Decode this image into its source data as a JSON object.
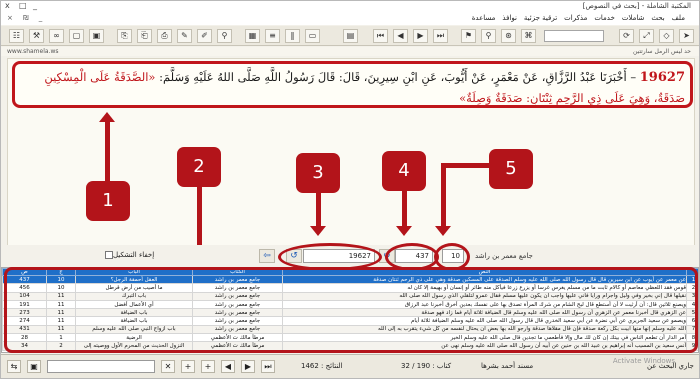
{
  "window": {
    "title": "المكتبة الشاملة - [بحث في النصوص]",
    "controls": [
      "_",
      "□",
      "x"
    ]
  },
  "menu": {
    "items": [
      "ملف",
      "بحث",
      "شاملات",
      "خدمات",
      "مذكرات",
      "ترقية جزئية",
      "نوافذ",
      "مساعدة"
    ],
    "mini": "_ ₪ ×"
  },
  "infostrip": {
    "right": "حد ليس الرمل سارتتين",
    "left": "www.shamela.ws"
  },
  "hadith": {
    "number": "19627",
    "isnad": "– أَخْبَرَنَا عَبْدُ الرَّزَّاقِ، عَنْ مَعْمَرٍ، عَنْ أَيُّوبَ، عَنِ ابْنِ سِيرِينَ، قَالَ: قَالَ رَسُولُ اللَّهِ صَلَّى اللهُ عَلَيْهِ وَسَلَّمَ: ",
    "matn": "«الصَّدَقَةُ عَلَى الْمِسْكِينِ صَدَقَةٌ، وَهِيَ عَلَى ذِي الرَّحِمِ ثِنْتَانِ: صَدَقَةٌ وَصِلَةٌ»"
  },
  "controls": {
    "checkbox_label": "إخفاء التشكيل",
    "hadith_field": "19627",
    "page_field": "437",
    "part_field": "10",
    "book_label": "جامع معمر بن راشد"
  },
  "callouts": [
    "1",
    "2",
    "3",
    "4",
    "5"
  ],
  "table": {
    "headers": [
      "",
      "النص",
      "الكتاب",
      "الباب",
      "ج",
      "ص"
    ],
    "rows": [
      [
        "1",
        "عن معمر عن أيوب عن ابن سيرين قال قال رسول الله صلى الله عليه وسلم الصدقة على المسكين صدقة وهي على ذي الرحم ثنتان صدقة",
        "جامع معمر بن راشد",
        "العقل أحمقة الرجل؟",
        "10",
        "437"
      ],
      [
        "2",
        "قوس فقد اللعظي معاصم أو كالام ثابت ما من مسلم يغرس غرسا أو يزرع زرعا فيأكل منه طائر أو إنسان أو بهيمة إلا كان له",
        "جامع معمر بن راشد",
        "ما أصيب من أرض قرطل",
        "10",
        "456"
      ],
      [
        "3",
        "نقيلها قال إني بخير وفي وليل وأجرام ورأيا فاني عليها وأجب أن يكون عليها مسلم فقال عمرو لتلقلي الذي رسول الله صلى الله",
        "جامع معمر بن راشد",
        "باب التبرك",
        "11",
        "104"
      ],
      [
        "4",
        "ويصنع ثلاثين قال: أن أرثيت لا أن أستطع قال لبح الشام من شرك المرأة تصدق بها على نفسك بعدين أخرق أخبرنا عبد الرزاق",
        "جامع معمر بن راشد",
        "أي الأعمال أفضل",
        "11",
        "191"
      ],
      [
        "5",
        "عن الزهري قال أخبرنا معمر عن الزهري أن رسول الله صلى الله عليه وسلم قال الضيافة ثلاثة أيام فما زاد فهو صدقة",
        "جامع معمر بن راشد",
        "باب الضيافة",
        "11",
        "273"
      ],
      [
        "6",
        "ويصمو عن سعيد الجريري عن أبي نضرة عن أبي سعيد الخدري قال قال رسول الله صلى الله عليه وسلم الضيافة ثلاثة أيام",
        "جامع معمر بن راشد",
        "باب الضيافة",
        "11",
        "274"
      ],
      [
        "7",
        "الله عليه وسلم إنها منها أبيت بكل ركعة صدقة فإن قال مقلاها صدقة وأرجو الله بها بعض أن يحتال لنفسه من كل شيء يتقرب به إلى الله",
        "جامع معمر بن راشد",
        "باب أزواج النبي صلى الله عليه وسلم",
        "11",
        "431"
      ],
      [
        "8",
        "أمر الدار أن تطعم الناس في بيتك إن كان لك مال وإلا فأطعمي ما تجدين قال صلى الله عليه وسلم الخير",
        "مرطأ مالك ت الأعظمي",
        "الرضية",
        "1",
        "28"
      ],
      [
        "9",
        "أنس سعيد بن المسيب أنه إبراهيم بن عبيد الله بن حنين عن أبيه أن رسول الله صلى الله عليه وسلم نهى عن",
        "مرطأ مالك ت الأعظمي",
        "النزول الحديث من المحرم الأول ووصيته إلى",
        "2",
        "34"
      ]
    ]
  },
  "status": {
    "results": "النتائج : 1462",
    "book": "كتاب : 190 / 32",
    "scope": "مسند أحمد بشرها",
    "right": "جاري البحث عن",
    "watermark": "Activate Windows"
  }
}
